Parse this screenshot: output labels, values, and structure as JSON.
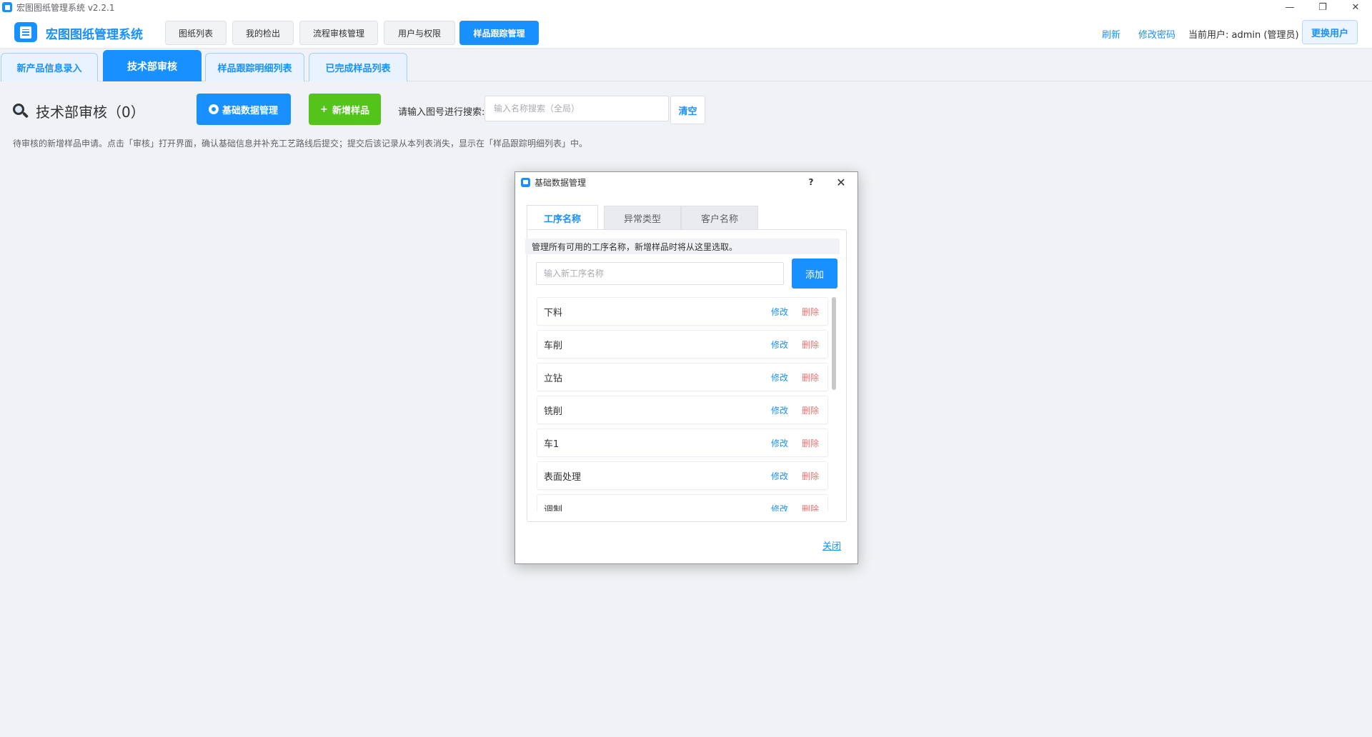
{
  "window": {
    "title": "宏图图纸管理系统  v2.2.1",
    "min_glyph": "—",
    "restore_glyph": "❐",
    "close_glyph": "✕"
  },
  "header": {
    "brand": "宏图图纸管理系统",
    "nav": [
      {
        "label": "图纸列表",
        "active": false
      },
      {
        "label": "我的检出",
        "active": false
      },
      {
        "label": "流程审核管理",
        "active": false
      },
      {
        "label": "用户与权限",
        "active": false
      },
      {
        "label": "样品跟踪管理",
        "active": true
      }
    ],
    "refresh": "刷新",
    "change_password": "修改密码",
    "current_user": "当前用户: admin (管理员)",
    "switch_user": "更换用户"
  },
  "subtabs": [
    {
      "label": "新产品信息录入",
      "active": false
    },
    {
      "label": "技术部审核",
      "active": true
    },
    {
      "label": "样品跟踪明细列表",
      "active": false
    },
    {
      "label": "已完成样品列表",
      "active": false
    }
  ],
  "page": {
    "title": "技术部审核（0）",
    "basic_data_button": "基础数据管理",
    "add_sample_button": "新增样品",
    "add_sample_plus": "+",
    "search_label": "请输入图号进行搜索:",
    "search_placeholder": "输入名称搜索（全局）",
    "search_value": "",
    "clear_button": "清空",
    "hint": "待审核的新增样品申请。点击「审核」打开界面，确认基础信息并补充工艺路线后提交；提交后该记录从本列表消失，显示在「样品跟踪明细列表」中。"
  },
  "dialog": {
    "title": "基础数据管理",
    "help": "?",
    "close_glyph": "✕",
    "tabs": [
      {
        "label": "工序名称",
        "active": true
      },
      {
        "label": "异常类型",
        "active": false
      },
      {
        "label": "客户名称",
        "active": false
      }
    ],
    "hint": "管理所有可用的工序名称，新增样品时将从这里选取。",
    "input_placeholder": "输入新工序名称",
    "input_value": "",
    "add_button": "添加",
    "edit_label": "修改",
    "delete_label": "删除",
    "items": [
      {
        "name": "下料"
      },
      {
        "name": "车削"
      },
      {
        "name": "立钻"
      },
      {
        "name": "铣削"
      },
      {
        "name": "车1"
      },
      {
        "name": "表面处理"
      },
      {
        "name": "调制"
      }
    ],
    "footer_close": "关闭"
  },
  "colors": {
    "primary": "#1890ff",
    "success": "#52c41a",
    "danger": "#f56c6c",
    "background": "#f0f2f5"
  }
}
